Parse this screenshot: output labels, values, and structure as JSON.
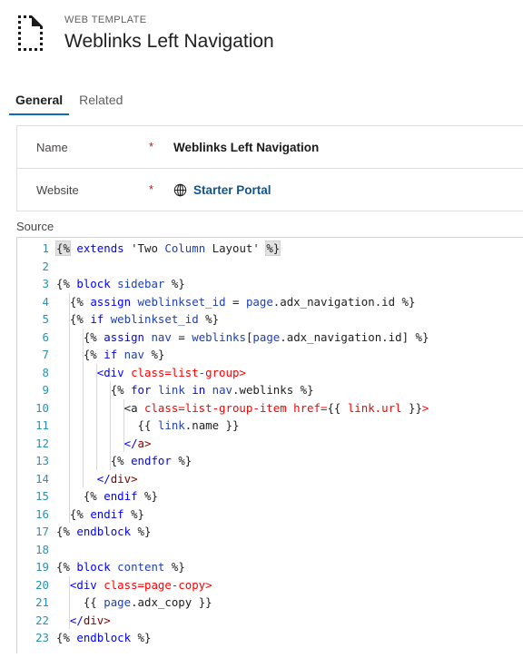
{
  "header": {
    "icon": "web-template-document-icon",
    "eyebrow": "WEB TEMPLATE",
    "title": "Weblinks Left Navigation"
  },
  "tabs": [
    {
      "label": "General",
      "selected": true
    },
    {
      "label": "Related",
      "selected": false
    }
  ],
  "form": {
    "rows": [
      {
        "label": "Name",
        "required": "*",
        "value": "Weblinks Left Navigation",
        "is_link": false,
        "icon": null
      },
      {
        "label": "Website",
        "required": "*",
        "value": "Starter Portal",
        "is_link": true,
        "icon": "globe-icon"
      }
    ]
  },
  "source": {
    "label": "Source",
    "language": "liquid-html",
    "line_count": 23,
    "lines": [
      {
        "n": "1",
        "text": "{% extends 'Two Column Layout' %}"
      },
      {
        "n": "2",
        "text": ""
      },
      {
        "n": "3",
        "text": "{% block sidebar %}"
      },
      {
        "n": "4",
        "text": "  {% assign weblinkset_id = page.adx_navigation.id %}"
      },
      {
        "n": "5",
        "text": "  {% if weblinkset_id %}"
      },
      {
        "n": "6",
        "text": "    {% assign nav = weblinks[page.adx_navigation.id] %}"
      },
      {
        "n": "7",
        "text": "    {% if nav %}"
      },
      {
        "n": "8",
        "text": "      <div class=list-group>"
      },
      {
        "n": "9",
        "text": "        {% for link in nav.weblinks %}"
      },
      {
        "n": "10",
        "text": "          <a class=list-group-item href={{ link.url }}>"
      },
      {
        "n": "11",
        "text": "            {{ link.name }}"
      },
      {
        "n": "12",
        "text": "          </a>"
      },
      {
        "n": "13",
        "text": "        {% endfor %}"
      },
      {
        "n": "14",
        "text": "      </div>"
      },
      {
        "n": "15",
        "text": "    {% endif %}"
      },
      {
        "n": "16",
        "text": "  {% endif %}"
      },
      {
        "n": "17",
        "text": "{% endblock %}"
      },
      {
        "n": "18",
        "text": ""
      },
      {
        "n": "19",
        "text": "{% block content %}"
      },
      {
        "n": "20",
        "text": "  <div class=page-copy>"
      },
      {
        "n": "21",
        "text": "    {{ page.adx_copy }}"
      },
      {
        "n": "22",
        "text": "  </div>"
      },
      {
        "n": "23",
        "text": "{% endblock %}"
      }
    ]
  },
  "colors": {
    "accent": "#0f6cbd",
    "required": "#a4262c",
    "link": "#0f548c",
    "keyword": "#0000ff",
    "attribute": "#ff0000",
    "tag_close": "#800000",
    "line_number": "#2b91af"
  }
}
